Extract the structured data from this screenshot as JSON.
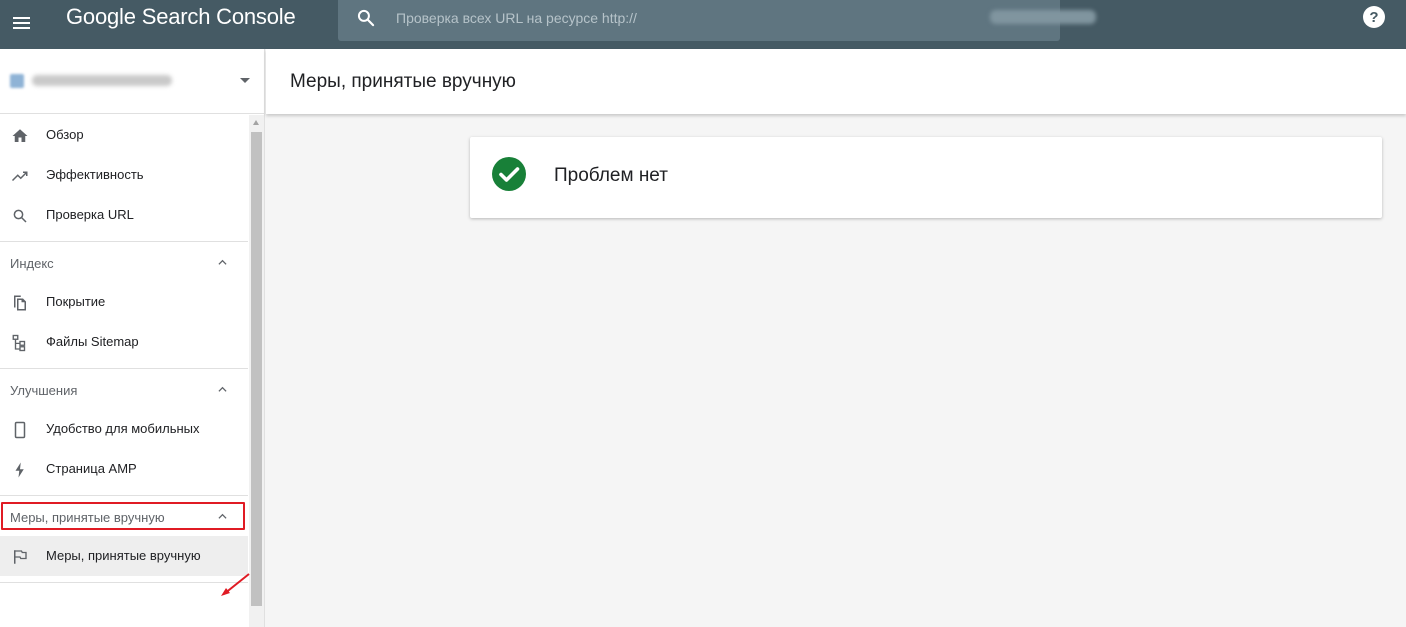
{
  "app": {
    "name_part1": "Google",
    "name_part2": "Search Console"
  },
  "topbar": {
    "search_placeholder": "Проверка всех URL на ресурсе http://",
    "help_label": "?"
  },
  "sidebar": {
    "top_items": [
      {
        "label": "Обзор",
        "icon": "home-icon"
      },
      {
        "label": "Эффективность",
        "icon": "trending-up-icon"
      },
      {
        "label": "Проверка URL",
        "icon": "search-icon"
      }
    ],
    "sections": [
      {
        "label": "Индекс",
        "items": [
          {
            "label": "Покрытие",
            "icon": "copy-pages-icon"
          },
          {
            "label": "Файлы Sitemap",
            "icon": "sitemap-icon"
          }
        ]
      },
      {
        "label": "Улучшения",
        "items": [
          {
            "label": "Удобство для мобильных",
            "icon": "smartphone-icon"
          },
          {
            "label": "Страница AMP",
            "icon": "flash-icon"
          }
        ]
      },
      {
        "label": "Меры, принятые вручную",
        "items": [
          {
            "label": "Меры, принятые вручную",
            "icon": "flag-icon",
            "active": true
          }
        ]
      }
    ]
  },
  "main": {
    "page_title": "Меры, принятые вручную",
    "status_text": "Проблем нет"
  },
  "colors": {
    "topbar": "#455a64",
    "search_box": "#5f7580",
    "success_green": "#188038",
    "highlight_red": "#e01b24"
  }
}
